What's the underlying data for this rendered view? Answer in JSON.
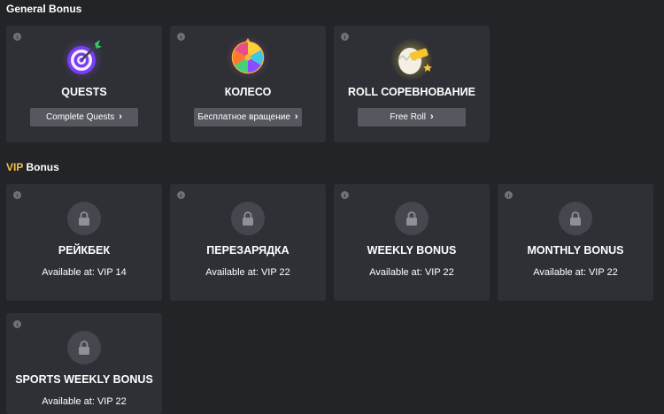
{
  "sections": {
    "general_title": "General Bonus",
    "vip_title_accent": "VIP",
    "vip_title_rest": " Bonus"
  },
  "colors": {
    "background": "#232428",
    "card": "#2e3035",
    "button": "#55585f",
    "vip_accent": "#f3c04a",
    "lock_circle": "#44474d"
  },
  "general_cards": [
    {
      "title": "QUESTS",
      "button": "Complete Quests",
      "icon": "target-dart-icon"
    },
    {
      "title": "КОЛЕСО",
      "button": "Бесплатное вращение",
      "icon": "fortune-wheel-icon"
    },
    {
      "title": "ROLL СОРЕВНОВАНИЕ",
      "button": "Free Roll",
      "icon": "free-egg-icon"
    }
  ],
  "vip_cards": [
    {
      "title": "РЕЙКБЕК",
      "available": "Available at: VIP 14",
      "icon": "lock-icon"
    },
    {
      "title": "ПЕРЕЗАРЯДКА",
      "available": "Available at: VIP 22",
      "icon": "lock-icon"
    },
    {
      "title": "WEEKLY BONUS",
      "available": "Available at: VIP 22",
      "icon": "lock-icon"
    },
    {
      "title": "MONTHLY BONUS",
      "available": "Available at: VIP 22",
      "icon": "lock-icon"
    },
    {
      "title": "SPORTS WEEKLY BONUS",
      "available": "Available at: VIP 22",
      "icon": "lock-icon"
    }
  ]
}
